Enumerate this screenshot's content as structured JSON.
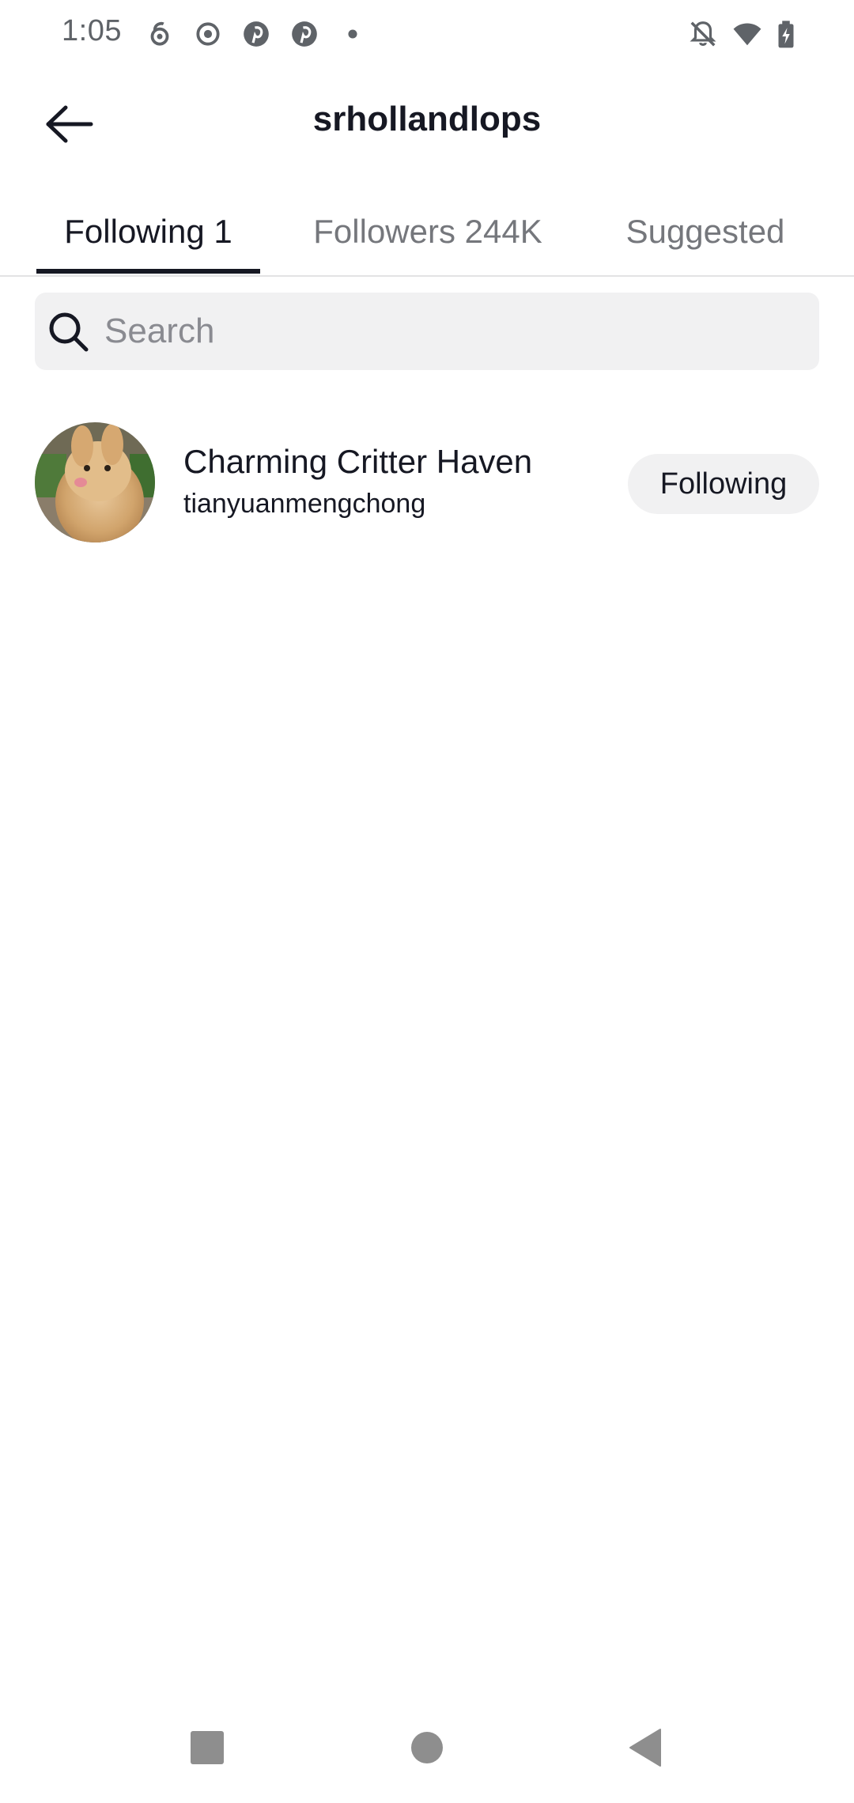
{
  "status_bar": {
    "time": "1:05",
    "icons": [
      "app-notification-icon",
      "record-icon",
      "pinterest-icon",
      "pinterest-icon",
      "dot-icon",
      "bell-off-icon",
      "wifi-icon",
      "battery-charging-icon"
    ]
  },
  "header": {
    "title": "srhollandlops",
    "back_icon": "arrow-left-icon"
  },
  "tabs": [
    {
      "label": "Following 1",
      "active": true
    },
    {
      "label": "Followers 244K",
      "active": false
    },
    {
      "label": "Suggested",
      "active": false
    }
  ],
  "search": {
    "placeholder": "Search",
    "value": ""
  },
  "users": [
    {
      "display_name": "Charming Critter Haven",
      "handle": "tianyuanmengchong",
      "button_label": "Following"
    }
  ],
  "nav_bar": {
    "buttons": [
      "recents-square-icon",
      "home-circle-icon",
      "back-triangle-icon"
    ]
  },
  "colors": {
    "text_primary": "#161823",
    "text_secondary": "#75777c",
    "surface": "#f1f1f2",
    "divider": "#e3e3e4"
  }
}
